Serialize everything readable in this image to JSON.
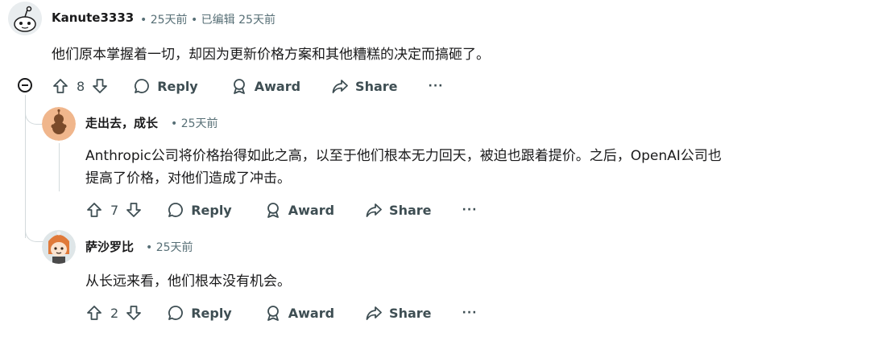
{
  "comments": [
    {
      "author": "Kanute3333",
      "meta": "• 25天前 • 已编辑 25天前",
      "body": "他们原本掌握着一切，却因为更新价格方案和其他糟糕的决定而搞砸了。",
      "votes": "8",
      "reply_label": "Reply",
      "award_label": "Award",
      "share_label": "Share",
      "more_label": "···"
    },
    {
      "author": "走出去，成长",
      "meta": "• 25天前",
      "body_lines": [
        "Anthropic公司将价格抬得如此之高，以至于他们根本无力回天，被迫也跟着提价。之后，OpenAI公司也",
        "提高了价格，对他们造成了冲击。"
      ],
      "votes": "7",
      "reply_label": "Reply",
      "award_label": "Award",
      "share_label": "Share",
      "more_label": "···"
    },
    {
      "author": "萨沙罗比",
      "meta": "• 25天前",
      "body": "从长远来看，他们根本没有机会。",
      "votes": "2",
      "reply_label": "Reply",
      "award_label": "Award",
      "share_label": "Share",
      "more_label": "···"
    }
  ]
}
